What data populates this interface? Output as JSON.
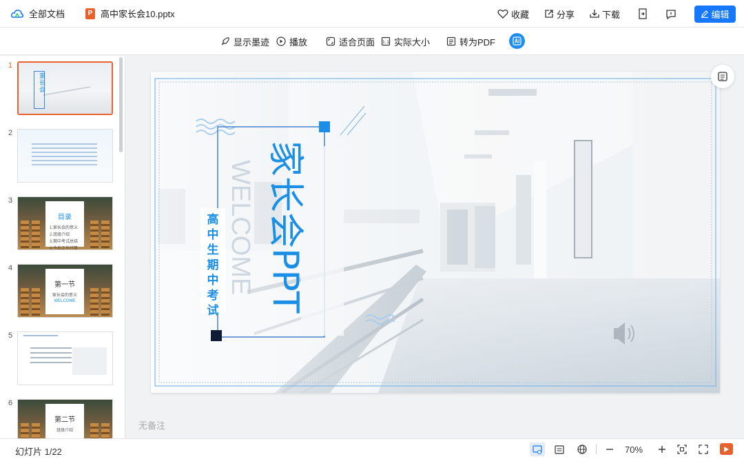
{
  "topbar": {
    "all_docs_label": "全部文档",
    "file_badge": "P",
    "file_name": "高中家长会10.pptx",
    "favorite_label": "收藏",
    "share_label": "分享",
    "download_label": "下载",
    "edit_label": "编辑"
  },
  "toolbar": {
    "show_ink": "显示墨迹",
    "play": "播放",
    "fit_page": "适合页面",
    "actual_size": "实际大小",
    "to_pdf": "转为PDF"
  },
  "sidebar": {
    "slides": [
      {
        "num": "1",
        "type": "corridor",
        "title": "家长会"
      },
      {
        "num": "2",
        "type": "light"
      },
      {
        "num": "3",
        "type": "class",
        "heading": "目录",
        "items": [
          "1.家长会的意义",
          "2.班级介绍",
          "3.期中考试总结",
          "4.今后工作打算"
        ]
      },
      {
        "num": "4",
        "type": "class",
        "heading": "第一节",
        "sub": "家长会的意义",
        "welcome": "WELCOME"
      },
      {
        "num": "5",
        "type": "white"
      },
      {
        "num": "6",
        "type": "class",
        "heading": "第二节",
        "sub": "班级介绍"
      }
    ]
  },
  "slide": {
    "main_title": "家长会PPT",
    "subtitle": "高中生期中考试",
    "watermark": "WELCOME"
  },
  "notes_placeholder": "无备注",
  "statusbar": {
    "slide_counter": "幻灯片 1/22",
    "zoom": "70%"
  },
  "colors": {
    "accent": "#1677ff",
    "ppt_orange": "#e8612c",
    "slide_blue": "#1b8fe6"
  }
}
